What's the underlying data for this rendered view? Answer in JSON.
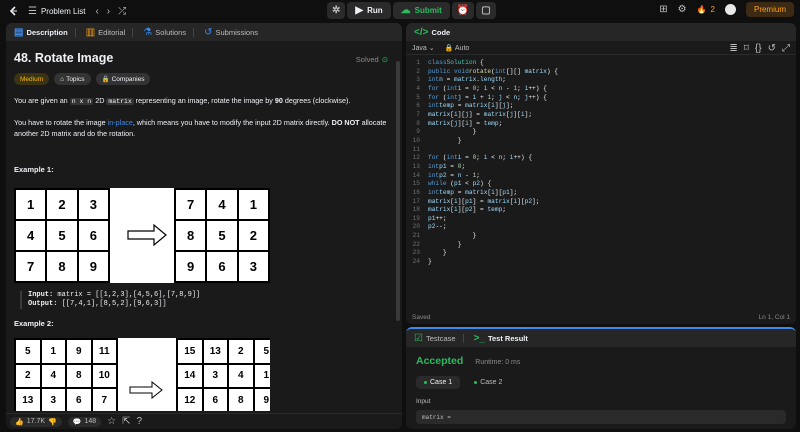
{
  "topbar": {
    "problem_list": "Problem List",
    "run": "Run",
    "submit": "Submit",
    "streak": "2",
    "premium": "Premium"
  },
  "left": {
    "tabs": [
      "Description",
      "Editorial",
      "Solutions",
      "Submissions"
    ],
    "title": "48. Rotate Image",
    "solved": "Solved",
    "difficulty": "Medium",
    "topics": "Topics",
    "companies": "Companies",
    "desc1_a": "You are given an ",
    "desc1_code1": "n x n",
    "desc1_b": " 2D ",
    "desc1_code2": "matrix",
    "desc1_c": " representing an image, rotate the image by ",
    "desc1_bold": "90",
    "desc1_d": " degrees (clockwise).",
    "desc2_a": "You have to rotate the image ",
    "desc2_link": "in-place",
    "desc2_b": ", which means you have to modify the input 2D matrix directly. ",
    "desc2_bold": "DO NOT",
    "desc2_c": " allocate another 2D matrix and do the rotation.",
    "example1_title": "Example 1:",
    "example1_input_label": "Input:",
    "example1_input": " matrix = [[1,2,3],[4,5,6],[7,8,9]]",
    "example1_output_label": "Output:",
    "example1_output": " [[7,4,1],[8,5,2],[9,6,3]]",
    "example2_title": "Example 2:",
    "grid1_left": [
      "1",
      "2",
      "3",
      "4",
      "5",
      "6",
      "7",
      "8",
      "9"
    ],
    "grid1_right": [
      "7",
      "4",
      "1",
      "8",
      "5",
      "2",
      "9",
      "6",
      "3"
    ],
    "grid2_left": [
      "5",
      "1",
      "9",
      "11",
      "2",
      "4",
      "8",
      "10",
      "13",
      "3",
      "6",
      "7"
    ],
    "grid2_right": [
      "15",
      "13",
      "2",
      "5",
      "14",
      "3",
      "4",
      "1",
      "12",
      "6",
      "8",
      "9"
    ],
    "likes": "17.7K",
    "comments": "148"
  },
  "code": {
    "header": "Code",
    "language": "Java",
    "auto": "Auto",
    "saved": "Saved",
    "cursor": "Ln 1, Col 1"
  },
  "test": {
    "tab_testcase": "Testcase",
    "tab_result": "Test Result",
    "accepted": "Accepted",
    "runtime": "Runtime: 0 ms",
    "case1": "Case 1",
    "case2": "Case 2",
    "input_label": "Input",
    "input_preview": "matrix ="
  },
  "colors": {
    "accent_orange": "#ffa116",
    "green": "#2cbb5d",
    "link_blue": "#3e8ae8"
  }
}
